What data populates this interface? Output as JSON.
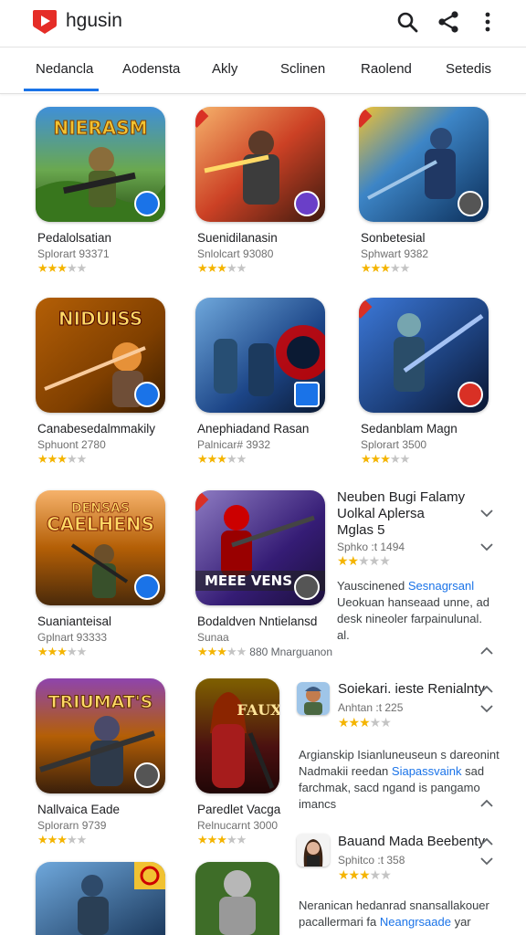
{
  "header": {
    "title": "hgusin",
    "icons": [
      "youtube-play-logo",
      "search-icon",
      "share-icon",
      "more-vert-icon"
    ],
    "accent": "#1a73e8",
    "logo_color": "#e52d27"
  },
  "tabs": [
    {
      "label": "Nedancla",
      "active": true
    },
    {
      "label": "Aodensta"
    },
    {
      "label": "Akly"
    },
    {
      "label": "Sclinen"
    },
    {
      "label": "Raolend"
    },
    {
      "label": "Setedis"
    }
  ],
  "cards": [
    {
      "name": "Pedalolsatian",
      "sub": "Splorart 93371",
      "rating": 3,
      "thumb_text": "NIERASM"
    },
    {
      "name": "Suenidilanasin",
      "sub": "Snlolcart 93080",
      "rating": 3
    },
    {
      "name": "Sonbetesial",
      "sub": "Sphwart 9382",
      "rating": 3
    },
    {
      "name": "Canabesedalmmakily",
      "sub": "Sphuont 2780",
      "rating": 3,
      "thumb_text": "NIDUISS"
    },
    {
      "name": "Anephiadand Rasan",
      "sub": "Palnicar# 3932",
      "rating": 3
    },
    {
      "name": "Sedanblam Magn",
      "sub": "Splorart 3500",
      "rating": 3
    },
    {
      "name": "Suanianteisal",
      "sub": "Gplnart 93333",
      "rating": 3,
      "thumb_text": "CAELHENS"
    },
    {
      "name": "Bodaldven Nntielansd",
      "sub": "Sunaa",
      "rating": 3,
      "extra": "880 Mnarguanon",
      "thumb_text": "MEEE VENS"
    },
    {
      "name": "Nallvaica Eade",
      "sub": "Splorarn 9739",
      "rating": 3,
      "thumb_text": "TRIUMAT'S"
    },
    {
      "name": "Paredlet Vacga",
      "sub": "Relnucarnt 3000",
      "rating": 3,
      "thumb_text": "FAUX"
    }
  ],
  "side": {
    "item1": {
      "title_lines": [
        "Neuben Bugi Falamy",
        "Uolkal Aplersa",
        "Mglas 5"
      ],
      "sub": "Sphko :t 1494",
      "rating": 2
    },
    "desc1": {
      "pre": "Yauscinened",
      "link": "Sesnagrsanl",
      "post": "Ueokuan hanseaad unne, ad desk nineoler farpainulunal. al."
    },
    "item2": {
      "title": "Soiekari. ieste Renialnty",
      "sub": "Anhtan :t 225",
      "rating": 3
    },
    "desc2": {
      "pre": "Argianskip Isianluneuseun s dareonint Nadmakii reedan",
      "link": "Siapassvaink",
      "post": "sad farchmak, sacd ngand is pangamo imancs"
    },
    "item3": {
      "title": "Bauand Mada Beebenty",
      "sub": "Sphitco :t 358",
      "rating": 3
    },
    "desc3": {
      "pre": "Neranican hedanrad snansallakouer pacallermari fa",
      "link": "Neangrsaade",
      "post": "yar"
    }
  }
}
